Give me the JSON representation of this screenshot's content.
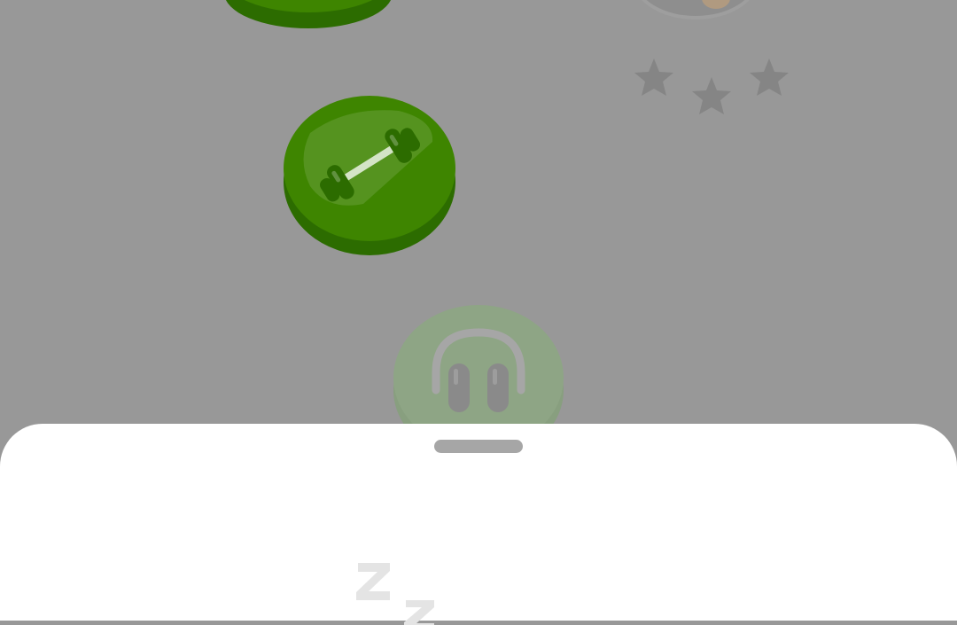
{
  "path": {
    "nodes": [
      {
        "id": "top-lesson",
        "state": "completed",
        "icon": "lesson-node"
      },
      {
        "id": "practice",
        "state": "completed",
        "icon": "dumbbell-icon"
      },
      {
        "id": "listening",
        "state": "locked",
        "icon": "headphones-icon"
      }
    ],
    "character_stars": {
      "count": 3,
      "earned": 0
    }
  },
  "sheet": {
    "state": "open",
    "illustration": "sleeping-zz-icon"
  },
  "colors": {
    "overlay": "#989898",
    "node_green": "#3e8500",
    "node_green_dark": "#2c6c00",
    "locked_node": "#8ea585",
    "star_gray": "#858585",
    "sheet_bg": "#ffffff",
    "handle": "#a6a6a6",
    "zz_gray": "#e4e4e4"
  }
}
